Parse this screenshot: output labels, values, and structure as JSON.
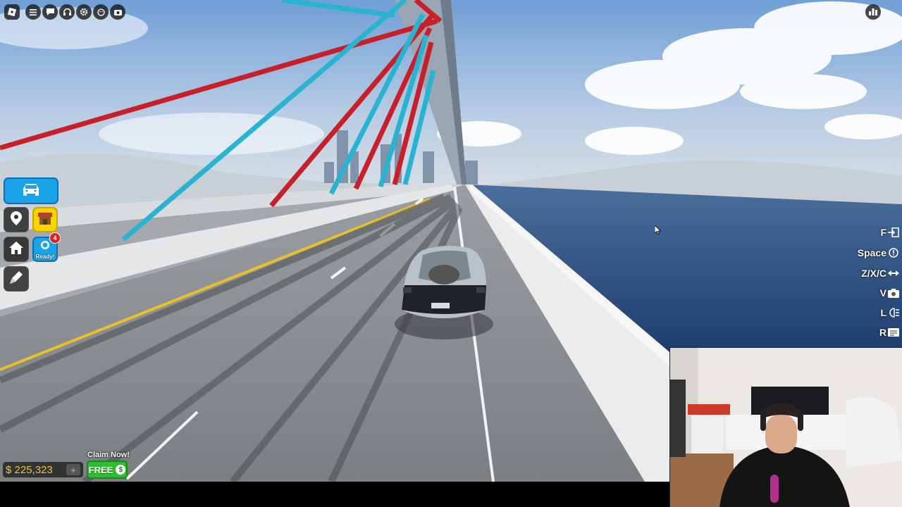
{
  "topbar": {
    "icons": [
      "roblox-menu-icon",
      "hamburger-icon",
      "chat-icon",
      "headset-icon",
      "settings-icon",
      "emote-icon",
      "screenshot-icon"
    ],
    "leaderboard_icon": "leaderboard-icon"
  },
  "left_menu": {
    "car_icon": "car-icon",
    "location_icon": "location-pin-icon",
    "shop_icon": "shop-icon",
    "home_icon": "home-icon",
    "reward": {
      "badge": "4",
      "label": "Ready!"
    },
    "tools_icon": "paint-icon"
  },
  "controls": [
    {
      "key": "F",
      "icon": "exit-icon"
    },
    {
      "key": "Space",
      "icon": "brake-icon"
    },
    {
      "key": "Z/X/C",
      "icon": "arrows-icon"
    },
    {
      "key": "V",
      "icon": "camera-icon"
    },
    {
      "key": "L",
      "icon": "headlights-icon"
    },
    {
      "key": "R",
      "icon": "reset-icon"
    }
  ],
  "currency": {
    "value": "$ 225,323",
    "add": "+"
  },
  "promo": {
    "title": "Claim Now!",
    "button": "FREE"
  },
  "colors": {
    "cable_red": "#c8202a",
    "cable_cyan": "#2ab3d0",
    "ui_blue": "#1aa3e8",
    "cash_gold": "#e9c24a",
    "free_green": "#2ebd2e"
  }
}
